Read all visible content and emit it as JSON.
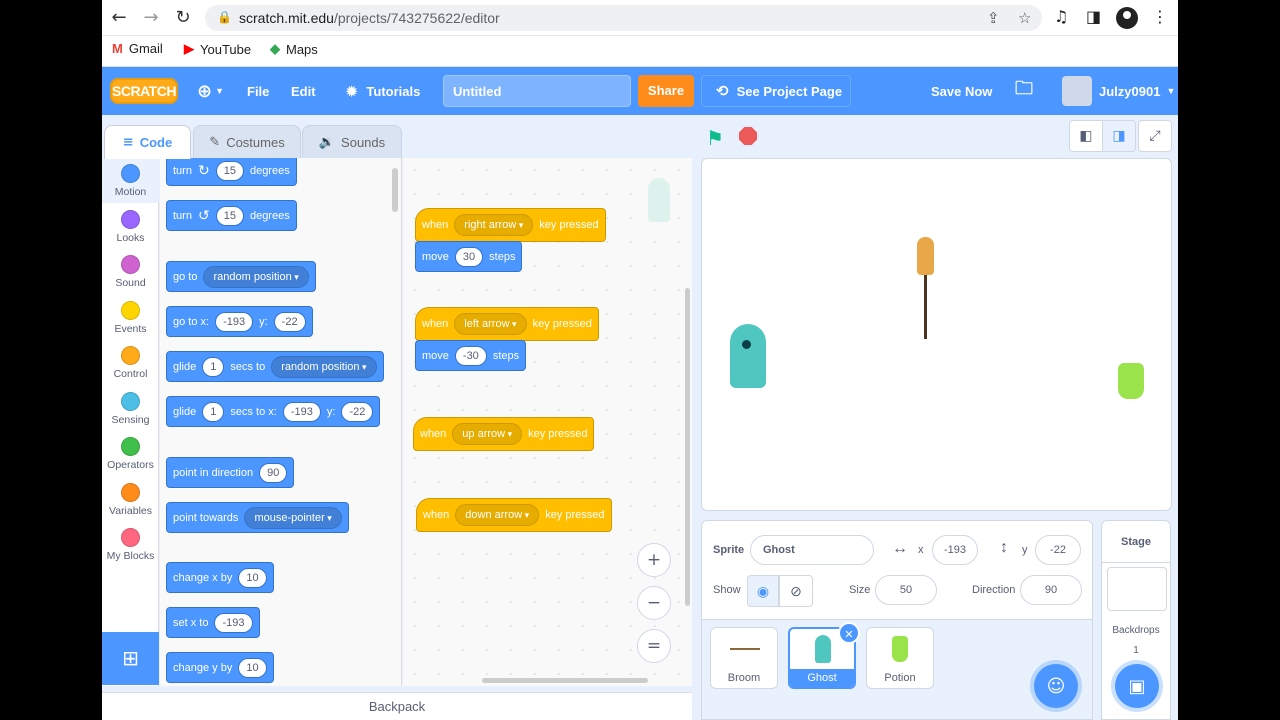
{
  "browser": {
    "url_host": "scratch.mit.edu",
    "url_path": "/projects/743275622/editor",
    "bookmarks": [
      {
        "label": "Gmail",
        "icon": "gmail-icon",
        "color": "#ea4335"
      },
      {
        "label": "YouTube",
        "icon": "youtube-icon",
        "color": "#ff0000"
      },
      {
        "label": "Maps",
        "icon": "maps-icon",
        "color": "#34a853"
      }
    ]
  },
  "menubar": {
    "logo": "SCRATCH",
    "file": "File",
    "edit": "Edit",
    "tutorials": "Tutorials",
    "project_title": "Untitled",
    "share": "Share",
    "see_project": "See Project Page",
    "save_now": "Save Now",
    "username": "Julzy0901"
  },
  "tabs": {
    "code": "Code",
    "costumes": "Costumes",
    "sounds": "Sounds"
  },
  "categories": [
    {
      "label": "Motion",
      "color": "#4c97ff"
    },
    {
      "label": "Looks",
      "color": "#9966ff"
    },
    {
      "label": "Sound",
      "color": "#cf63cf"
    },
    {
      "label": "Events",
      "color": "#ffd500"
    },
    {
      "label": "Control",
      "color": "#ffab19"
    },
    {
      "label": "Sensing",
      "color": "#4cbfe6"
    },
    {
      "label": "Operators",
      "color": "#40bf4a"
    },
    {
      "label": "Variables",
      "color": "#ff8c1a"
    },
    {
      "label": "My Blocks",
      "color": "#ff6680"
    }
  ],
  "palette": {
    "turn_right": {
      "pre": "turn",
      "val": "15",
      "post": "degrees"
    },
    "turn_left": {
      "pre": "turn",
      "val": "15",
      "post": "degrees"
    },
    "goto": {
      "pre": "go to",
      "dd": "random position"
    },
    "goto_xy": {
      "pre": "go to x:",
      "x": "-193",
      "ylbl": "y:",
      "y": "-22"
    },
    "glide_to": {
      "pre": "glide",
      "val": "1",
      "mid": "secs to",
      "dd": "random position"
    },
    "glide_xy": {
      "pre": "glide",
      "val": "1",
      "mid": "secs to x:",
      "x": "-193",
      "ylbl": "y:",
      "y": "-22"
    },
    "point_dir": {
      "pre": "point in direction",
      "val": "90"
    },
    "point_towards": {
      "pre": "point towards",
      "dd": "mouse-pointer"
    },
    "change_x": {
      "pre": "change x by",
      "val": "10"
    },
    "set_x": {
      "pre": "set x to",
      "val": "-193"
    },
    "change_y": {
      "pre": "change y by",
      "val": "10"
    }
  },
  "scripts": [
    {
      "when": "when",
      "key": "right arrow",
      "post": "key pressed",
      "move": "move",
      "steps_val": "30",
      "steps": "steps"
    },
    {
      "when": "when",
      "key": "left arrow",
      "post": "key pressed",
      "move": "move",
      "steps_val": "-30",
      "steps": "steps"
    },
    {
      "when": "when",
      "key": "up arrow",
      "post": "key pressed"
    },
    {
      "when": "when",
      "key": "down arrow",
      "post": "key pressed"
    }
  ],
  "zoom": {
    "in": "+",
    "out": "−",
    "reset": "="
  },
  "backpack": "Backpack",
  "sprite_info": {
    "sprite_label": "Sprite",
    "sprite_name": "Ghost",
    "x_label": "x",
    "x": "-193",
    "y_label": "y",
    "y": "-22",
    "show_label": "Show",
    "size_label": "Size",
    "size": "50",
    "direction_label": "Direction",
    "direction": "90"
  },
  "sprites": [
    {
      "name": "Broom"
    },
    {
      "name": "Ghost",
      "selected": true
    },
    {
      "name": "Potion"
    }
  ],
  "stage_pane": {
    "title": "Stage",
    "backdrops_label": "Backdrops",
    "backdrops_count": "1"
  },
  "colors": {
    "motion": "#4c97ff",
    "events": "#ffbf00",
    "accent": "#4c97ff",
    "share": "#ff8c1a"
  }
}
